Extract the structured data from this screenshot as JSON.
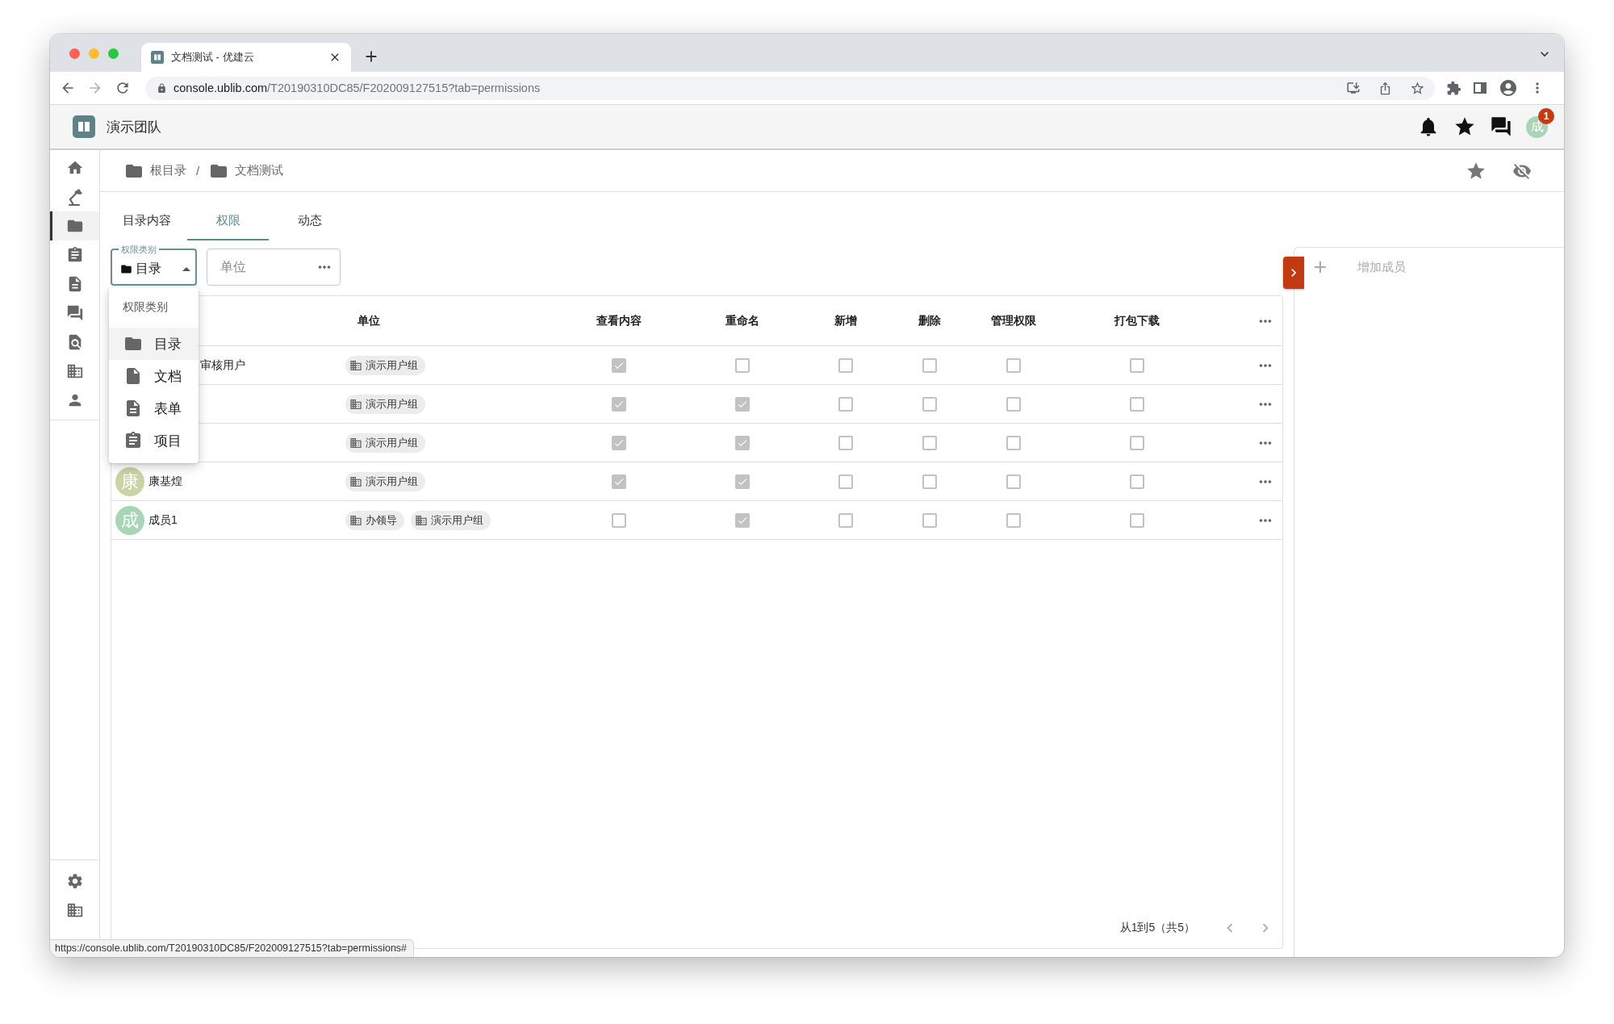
{
  "browser": {
    "tab_title": "文档测试 - 优建云",
    "url_host": "console.ublib.com",
    "url_path": "/T20190310DC85/F202009127515?tab=permissions",
    "status_url": "https://console.ublib.com/T20190310DC85/F202009127515?tab=permissions#"
  },
  "app": {
    "team": "演示团队",
    "notification_count": "1",
    "user_avatar": "成"
  },
  "sidebar": {
    "items": [
      {
        "selected": false
      },
      {
        "selected": false
      },
      {
        "selected": true
      },
      {
        "selected": false
      },
      {
        "selected": false
      },
      {
        "selected": false
      },
      {
        "selected": false
      },
      {
        "selected": false
      },
      {
        "selected": false
      }
    ]
  },
  "breadcrumb": [
    "根目录",
    "文档测试"
  ],
  "breadcrumb_separator": "/",
  "tabs": [
    {
      "label": "目录内容",
      "selected": false
    },
    {
      "label": "权限",
      "selected": true
    },
    {
      "label": "动态",
      "selected": false
    }
  ],
  "filters": {
    "category": {
      "label": "权限类别",
      "value": "目录",
      "expanded": true
    },
    "unit": {
      "placeholder": "单位"
    }
  },
  "category_menu": {
    "title": "权限类别",
    "items": [
      {
        "label": "目录",
        "selected": true
      },
      {
        "label": "文档",
        "selected": false
      },
      {
        "label": "表单",
        "selected": false
      },
      {
        "label": "项目",
        "selected": false
      }
    ]
  },
  "table": {
    "columns": [
      "单位",
      "查看内容",
      "重命名",
      "新增",
      "删除",
      "管理权限",
      "打包下载"
    ],
    "rows": [
      {
        "name": "审核用户",
        "units": [
          "演示用户组"
        ],
        "permissions": [
          true,
          false,
          false,
          false,
          false,
          false
        ]
      },
      {
        "units": [
          "演示用户组"
        ],
        "permissions": [
          true,
          true,
          false,
          false,
          false,
          false
        ]
      },
      {
        "units": [
          "演示用户组"
        ],
        "permissions": [
          true,
          true,
          false,
          false,
          false,
          false
        ]
      },
      {
        "name": "康基煌",
        "avatar": "康",
        "color": "#c9d3a5",
        "units": [
          "演示用户组"
        ],
        "permissions": [
          true,
          true,
          false,
          false,
          false,
          false
        ]
      },
      {
        "name": "成员1",
        "avatar": "成",
        "color": "#a9d4b6",
        "units": [
          "办领导",
          "演示用户组"
        ],
        "permissions": [
          false,
          true,
          false,
          false,
          false,
          false
        ]
      }
    ]
  },
  "pagination": "从1到5（共5）",
  "panel": {
    "add_member": "增加成员"
  }
}
